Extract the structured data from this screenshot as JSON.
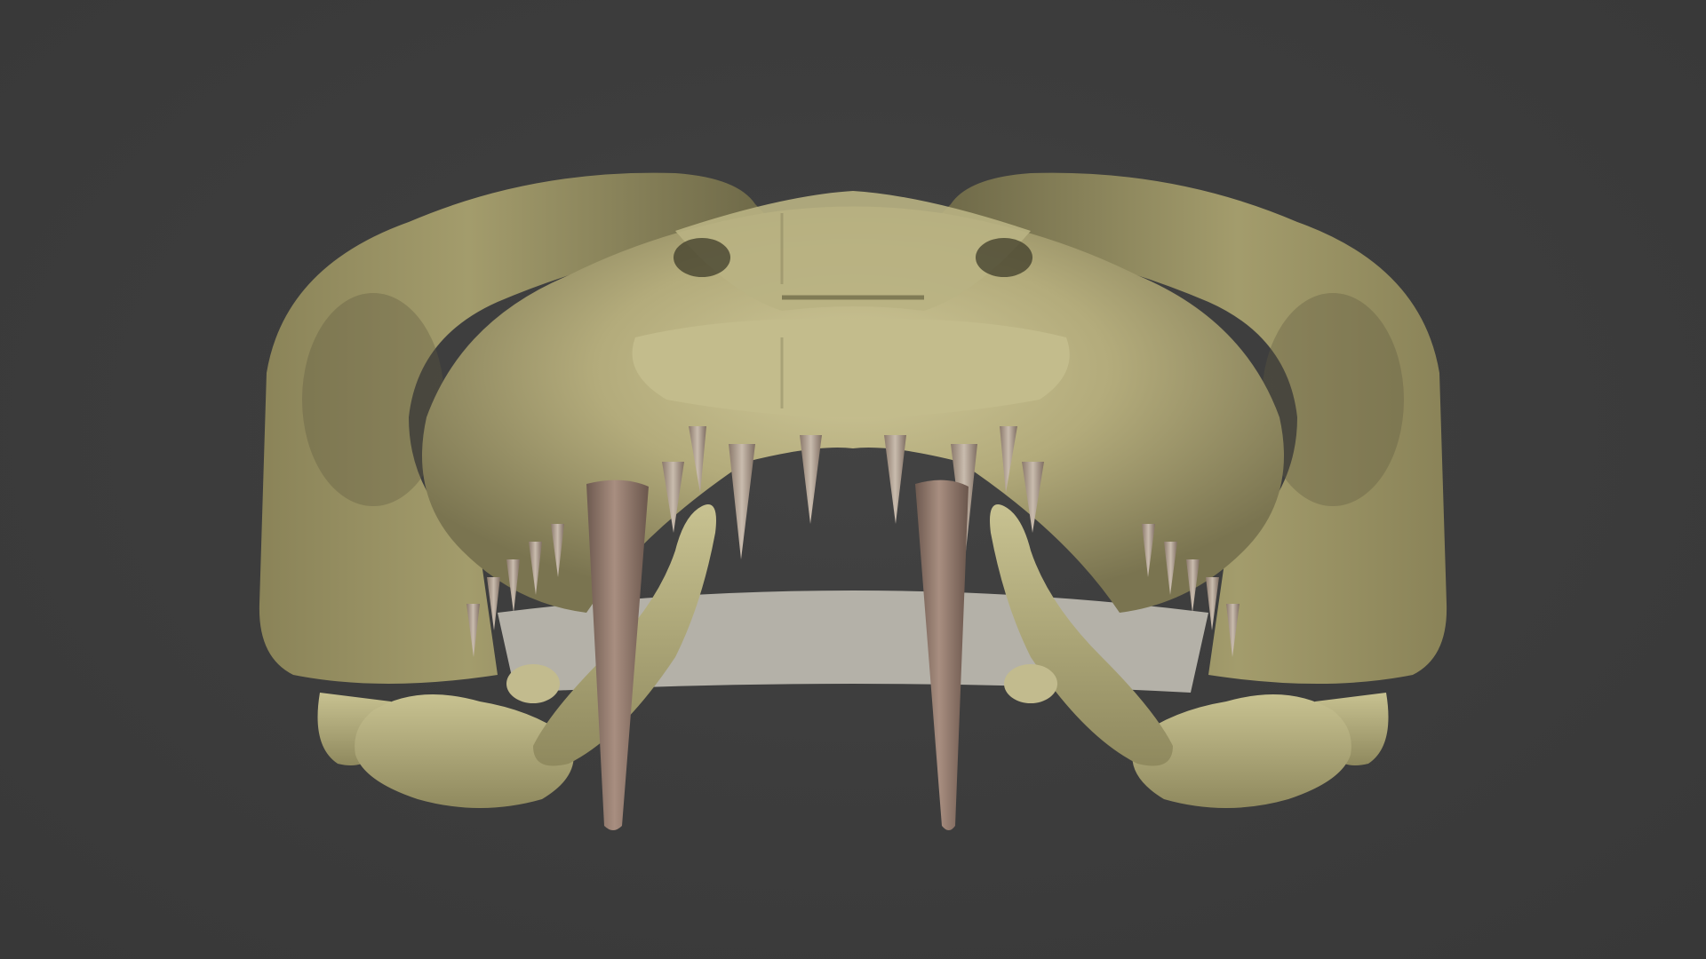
{
  "scene": {
    "subject_icon": "skull-render-icon",
    "background_color": "#3c3c3c",
    "bone_color": "#b7b07f",
    "bone_shadow_color": "#6f6a48",
    "tooth_color": "#8c7468"
  }
}
